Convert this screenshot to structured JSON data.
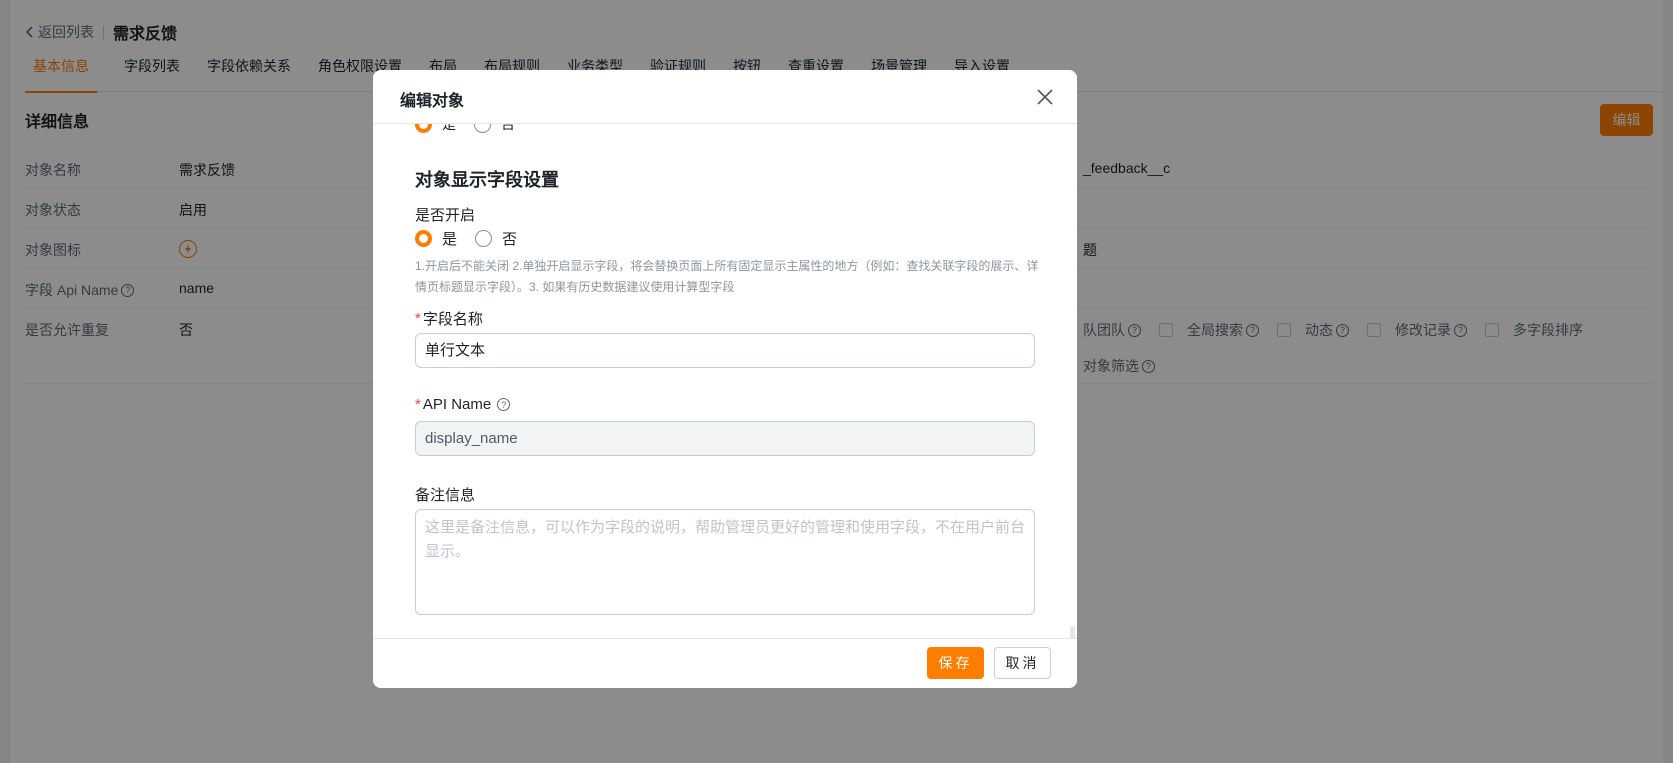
{
  "header": {
    "back_label": "返回列表",
    "title": "需求反馈"
  },
  "tabs": [
    {
      "label": "基本信息",
      "active": true
    },
    {
      "label": "字段列表"
    },
    {
      "label": "字段依赖关系"
    },
    {
      "label": "角色权限设置"
    },
    {
      "label": "布局"
    },
    {
      "label": "布局规则"
    },
    {
      "label": "业务类型"
    },
    {
      "label": "验证规则"
    },
    {
      "label": "按钮"
    },
    {
      "label": "查重设置"
    },
    {
      "label": "场景管理"
    },
    {
      "label": "导入设置"
    }
  ],
  "details": {
    "section_title": "详细信息",
    "edit_label": "编辑",
    "rows": [
      {
        "label": "对象名称",
        "value": "需求反馈",
        "right_value": "_feedback__c"
      },
      {
        "label": "对象状态",
        "value": "启用",
        "right_value": ""
      },
      {
        "label": "对象图标",
        "value": "",
        "right_value": "题"
      },
      {
        "label": "字段 Api Name",
        "value": "name",
        "right_value": ""
      },
      {
        "label": "是否允许重复",
        "value": "否",
        "right_value": ""
      }
    ],
    "options": [
      "队团队",
      "全局搜索",
      "动态",
      "修改记录",
      "多字段排序"
    ],
    "extra_option": "对象筛选"
  },
  "modal": {
    "title": "编辑对象",
    "peek_yes": "是",
    "peek_no": "否",
    "group_title": "对象显示字段设置",
    "enable_label": "是否开启",
    "radio_yes": "是",
    "radio_no": "否",
    "hint": "1.开启后不能关闭 2.单独开启显示字段，将会替换页面上所有固定显示主属性的地方（例如：查找关联字段的展示、详情页标题显示字段）。3. 如果有历史数据建议使用计算型字段",
    "field_name_label": "字段名称",
    "field_name_value": "单行文本",
    "api_name_label": "API Name",
    "api_name_value": "display_name",
    "remark_label": "备注信息",
    "remark_placeholder": "这里是备注信息，可以作为字段的说明，帮助管理员更好的管理和使用字段，不在用户前台显示。",
    "save_label": "保存",
    "cancel_label": "取消"
  },
  "colors": {
    "accent": "#ff7d00",
    "required": "#f53f3f",
    "mask": "rgba(0,0,0,0.45)"
  }
}
